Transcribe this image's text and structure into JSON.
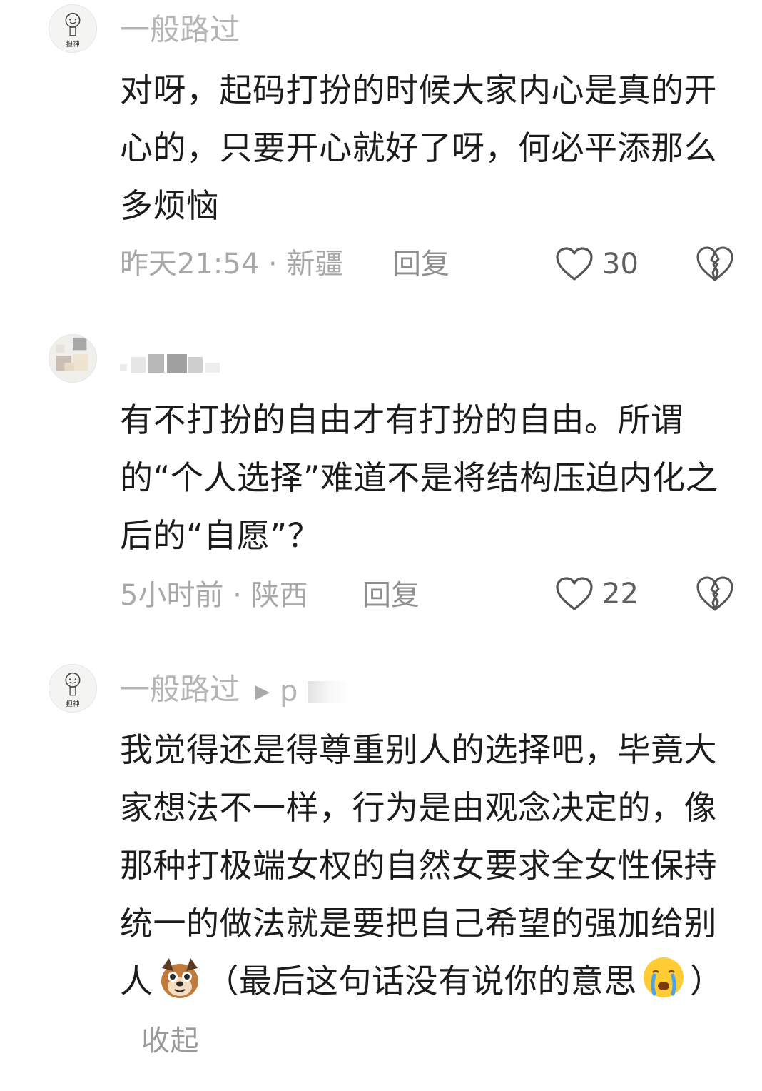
{
  "comments": [
    {
      "username": "一般路过",
      "avatar_caption": "担神",
      "text": "对呀，起码打扮的时候大家内心是真的开心的，只要开心就好了呀，何必平添那么多烦恼",
      "meta": "昨天21:54 · 新疆",
      "reply_label": "回复",
      "likes": "30"
    },
    {
      "username": "",
      "text": "有不打扮的自由才有打扮的自由。所谓的“个人选择”难道不是将结构压迫内化之后的“自愿”？",
      "meta": "5小时前 · 陕西",
      "reply_label": "回复",
      "likes": "22"
    },
    {
      "username": "一般路过",
      "avatar_caption": "担神",
      "reply_to": "p",
      "text_part1": "我觉得还是得尊重别人的选择吧，毕竟大家想法不一样，行为是由观念决定的，像那种打极端女权的自然女要求全女性保持统一的做法就是要把自己希望的强加给别人",
      "text_part2": "（最后这句话没有说你的意思",
      "text_part3": "）",
      "collapse_label": "收起"
    }
  ],
  "icons": {
    "like": "heart-outline-icon",
    "dislike": "broken-heart-icon",
    "reply_arrow": "play-triangle-icon",
    "emoji_dog": "dog-emoji",
    "emoji_cry": "crying-face-emoji"
  },
  "colors": {
    "username": "#b5b5b5",
    "text": "#1c1c1c",
    "meta": "#a8a8a8"
  }
}
